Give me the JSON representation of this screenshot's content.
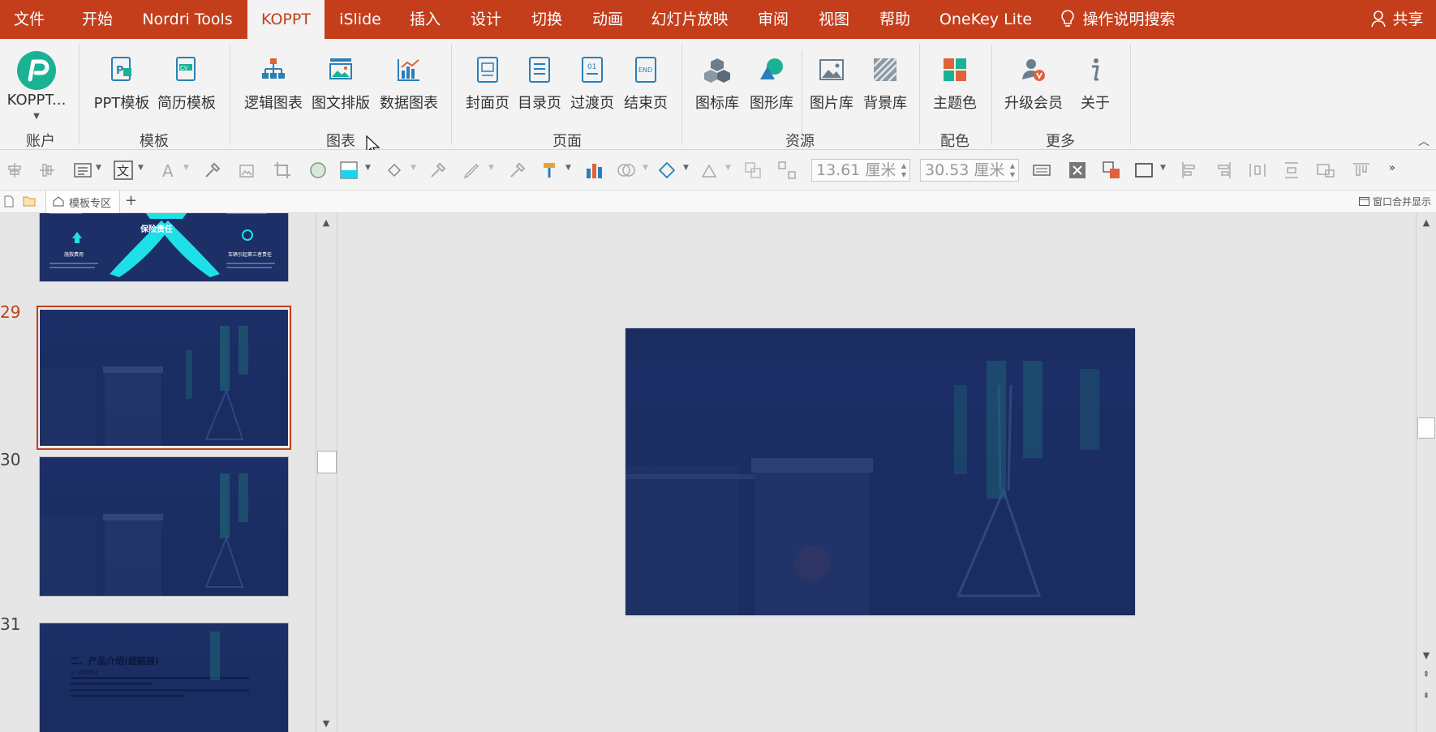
{
  "menu": {
    "file": "文件",
    "home": "开始",
    "nordri": "Nordri Tools",
    "koppt": "KOPPT",
    "islide": "iSlide",
    "insert": "插入",
    "design": "设计",
    "transitions": "切换",
    "animations": "动画",
    "slideshow": "幻灯片放映",
    "review": "审阅",
    "view": "视图",
    "help": "帮助",
    "onekey": "OneKey Lite",
    "search": "操作说明搜索",
    "share": "共享"
  },
  "ribbon": {
    "account_btn": "KOPPT...",
    "group_account": "账户",
    "ppt_template": "PPT模板",
    "resume_template": "简历模板",
    "group_template": "模板",
    "logic_chart": "逻辑图表",
    "text_image": "图文排版",
    "data_chart": "数据图表",
    "group_chart": "图表",
    "cover": "封面页",
    "toc": "目录页",
    "transition_page": "过渡页",
    "end_page": "结束页",
    "group_page": "页面",
    "icon_lib": "图标库",
    "shape_lib": "图形库",
    "image_lib": "图片库",
    "bg_lib": "背景库",
    "group_resource": "资源",
    "theme_color": "主题色",
    "group_color": "配色",
    "upgrade": "升级会员",
    "about": "关于",
    "group_more": "更多",
    "end_icon_text": "END",
    "toc_icon_text": "01"
  },
  "toolbar": {
    "height_value": "13.61 厘米",
    "width_value": "30.53 厘米"
  },
  "tabs": {
    "template_zone": "模板专区",
    "merge_windows": "窗口合并显示"
  },
  "thumbnails": {
    "top_partial": {
      "title": "保险责任",
      "left_label": "施救费用",
      "right_label": "车辆引起第三者责任"
    },
    "slide_numbers": [
      "29",
      "30",
      "31"
    ],
    "slide31": {
      "title": "二、产品介绍(超赔层)",
      "subtitle": "1、保险责任"
    }
  },
  "colors": {
    "accent": "#c43e1c",
    "slide_navy": "#1c2f66",
    "selected_border": "#c43e1c"
  }
}
